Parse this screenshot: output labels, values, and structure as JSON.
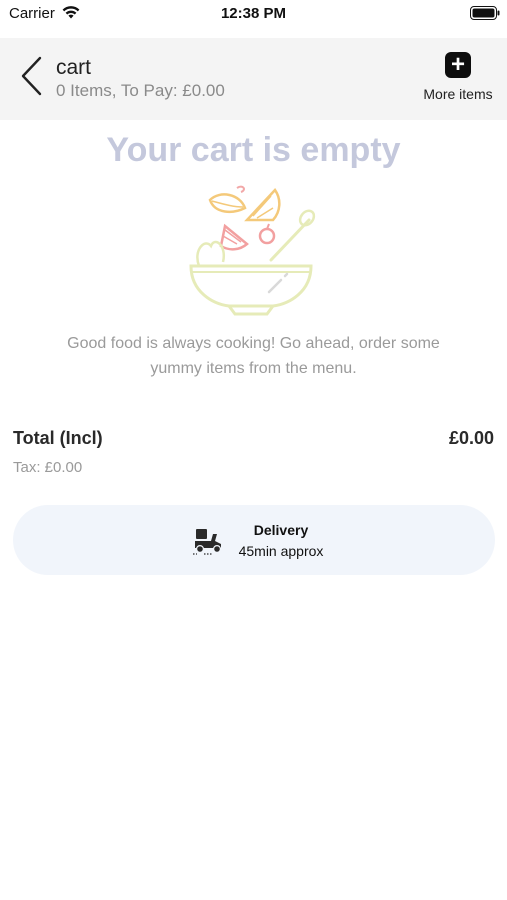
{
  "status_bar": {
    "carrier": "Carrier",
    "time": "12:38 PM",
    "icons": [
      "wifi-icon",
      "battery-icon"
    ]
  },
  "header": {
    "title": "cart",
    "subtitle": "0 Items, To Pay: £0.00",
    "back_icon": "chevron-left-icon",
    "more_items_label": "More items",
    "more_items_icon": "plus-icon",
    "more_items_icon_glyph": "+"
  },
  "empty_state": {
    "title": "Your cart is empty",
    "illustration": "salad-bowl-icon",
    "message": "Good food is always cooking! Go ahead, order some yummy items from the menu."
  },
  "summary": {
    "total_label": "Total (Incl)",
    "total_value": "£0.00",
    "tax": "Tax: £0.00"
  },
  "delivery": {
    "icon": "delivery-scooter-icon",
    "title": "Delivery",
    "time": "45min approx"
  },
  "colors": {
    "header_bg": "#f4f4f4",
    "empty_title": "#c4c8dc",
    "delivery_bg": "#f1f5fb",
    "muted_text": "#9a9a9a"
  }
}
